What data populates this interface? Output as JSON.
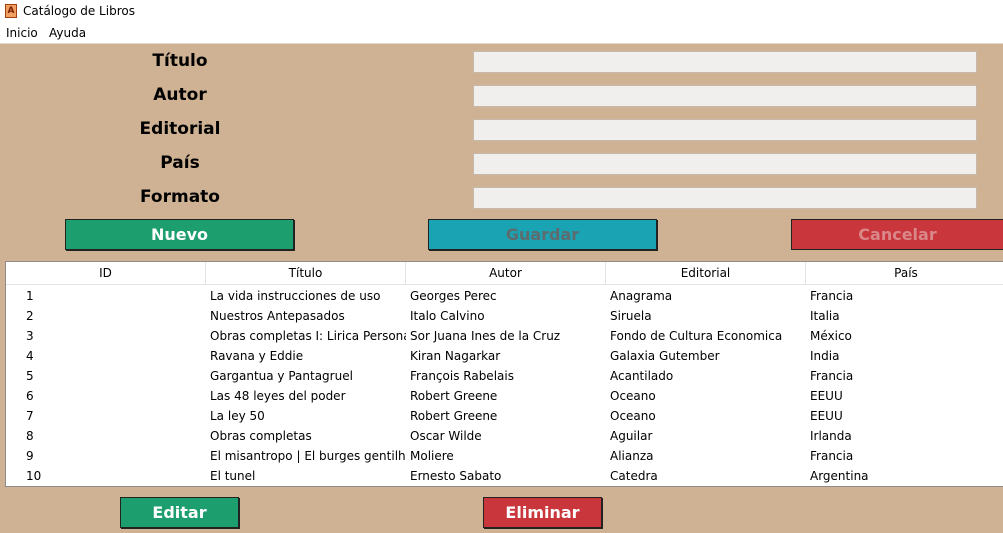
{
  "window": {
    "title": "Catálogo de Libros",
    "icon": "book-app-icon"
  },
  "menu": {
    "items": [
      "Inicio",
      "Ayuda"
    ]
  },
  "form": {
    "labels": [
      "Título",
      "Autor",
      "Editorial",
      "País",
      "Formato"
    ],
    "values": [
      "",
      "",
      "",
      "",
      ""
    ]
  },
  "buttons": {
    "nuevo": "Nuevo",
    "guardar": "Guardar",
    "cancelar": "Cancelar",
    "editar": "Editar",
    "eliminar": "Eliminar"
  },
  "table": {
    "columns": [
      "ID",
      "Título",
      "Autor",
      "Editorial",
      "País"
    ],
    "rows": [
      [
        "1",
        "La vida instrucciones de uso",
        "Georges Perec",
        "Anagrama",
        "Francia"
      ],
      [
        "2",
        "Nuestros Antepasados",
        "Italo Calvino",
        "Siruela",
        "Italia"
      ],
      [
        "3",
        "Obras completas I: Lirica Personal",
        "Sor Juana Ines de la Cruz",
        "Fondo de Cultura Economica",
        "México"
      ],
      [
        "4",
        "Ravana y Eddie",
        "Kiran Nagarkar",
        "Galaxia Gutember",
        "India"
      ],
      [
        "5",
        "Gargantua y Pantagruel",
        "François Rabelais",
        "Acantilado",
        "Francia"
      ],
      [
        "6",
        "Las 48 leyes del poder",
        "Robert Greene",
        "Oceano",
        "EEUU"
      ],
      [
        "7",
        "La ley 50",
        "Robert Greene",
        "Oceano",
        "EEUU"
      ],
      [
        "8",
        "Obras completas",
        "Oscar Wilde",
        "Aguilar",
        "Irlanda"
      ],
      [
        "9",
        "El misantropo | El burges gentilhombre",
        "Moliere",
        "Alianza",
        "Francia"
      ],
      [
        "10",
        "El tunel",
        "Ernesto Sabato",
        "Catedra",
        "Argentina"
      ]
    ]
  },
  "colors": {
    "background": "#cfb294",
    "green": "#1d9e6e",
    "teal": "#1aa3b3",
    "red": "#c9363b"
  }
}
